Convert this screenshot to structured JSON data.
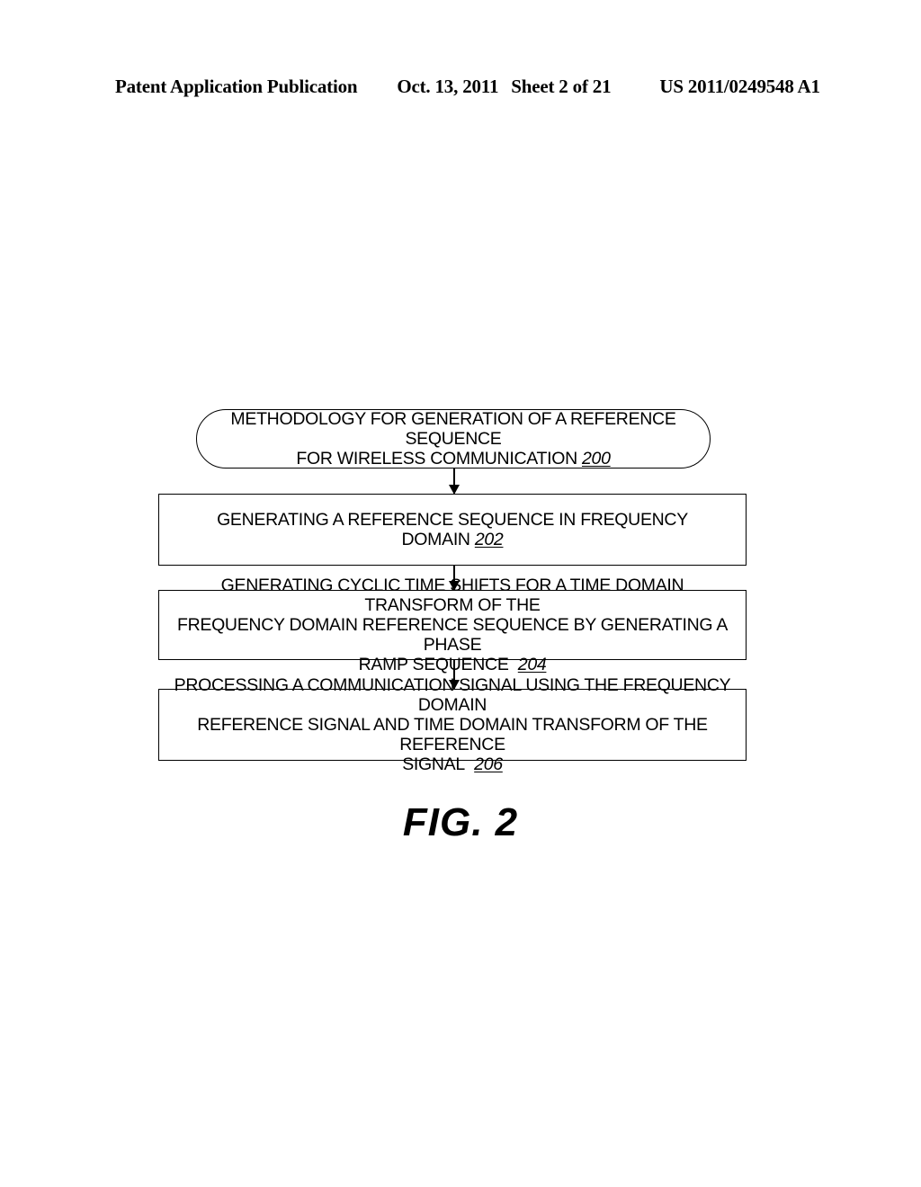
{
  "header": {
    "publication": "Patent Application Publication",
    "date": "Oct. 13, 2011",
    "sheet": "Sheet 2 of 21",
    "document_number": "US 2011/0249548 A1"
  },
  "figure": {
    "caption": "FIG. 2"
  },
  "flowchart": {
    "nodes": [
      {
        "shape": "stadium",
        "line1": "METHODOLOGY FOR  GENERATION OF A REFERENCE SEQUENCE",
        "line2": "FOR WIRELESS COMMUNICATION",
        "ref": "200"
      },
      {
        "shape": "rectangle",
        "line1": "GENERATING A REFERENCE SEQUENCE IN FREQUENCY DOMAIN",
        "ref": "202"
      },
      {
        "shape": "rectangle",
        "line1": "GENERATING CYCLIC TIME SHIFTS FOR A TIME DOMAIN TRANSFORM OF THE",
        "line2": "FREQUENCY DOMAIN REFERENCE SEQUENCE BY GENERATING A PHASE",
        "line3": "RAMP SEQUENCE",
        "ref": "204"
      },
      {
        "shape": "rectangle",
        "line1": "PROCESSING A COMMUNICATION SIGNAL USING THE FREQUENCY DOMAIN",
        "line2": "REFERENCE SIGNAL AND TIME DOMAIN TRANSFORM OF THE REFERENCE",
        "line3": "SIGNAL",
        "ref": "206"
      }
    ],
    "connectors": [
      {
        "from": "200",
        "to": "202"
      },
      {
        "from": "202",
        "to": "204"
      },
      {
        "from": "204",
        "to": "206"
      }
    ]
  },
  "colors": {
    "ink": "#000000",
    "paper": "#ffffff"
  }
}
